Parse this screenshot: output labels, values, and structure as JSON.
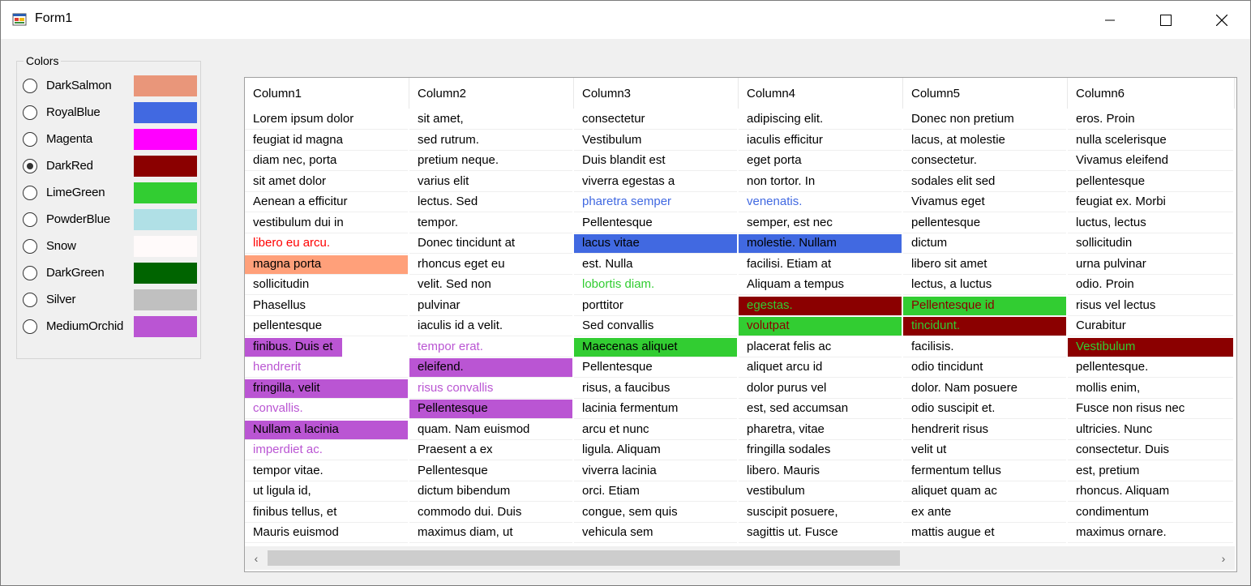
{
  "window": {
    "title": "Form1"
  },
  "colors": {
    "label": "Colors",
    "items": [
      {
        "name": "DarkSalmon",
        "hex": "#e9967a",
        "selected": false
      },
      {
        "name": "RoyalBlue",
        "hex": "#4169e1",
        "selected": false
      },
      {
        "name": "Magenta",
        "hex": "#ff00ff",
        "selected": false
      },
      {
        "name": "DarkRed",
        "hex": "#8b0000",
        "selected": true
      },
      {
        "name": "LimeGreen",
        "hex": "#32cd32",
        "selected": false
      },
      {
        "name": "PowderBlue",
        "hex": "#b0e0e6",
        "selected": false
      },
      {
        "name": "Snow",
        "hex": "#fffafa",
        "selected": false
      },
      {
        "name": "DarkGreen",
        "hex": "#006400",
        "selected": false
      },
      {
        "name": "Silver",
        "hex": "#c0c0c0",
        "selected": false
      },
      {
        "name": "MediumOrchid",
        "hex": "#ba55d3",
        "selected": false
      }
    ]
  },
  "grid": {
    "columns": [
      "Column1",
      "Column2",
      "Column3",
      "Column4",
      "Column5",
      "Column6"
    ],
    "rows": [
      [
        {
          "text": "Lorem ipsum dolor"
        },
        {
          "text": "sit amet,"
        },
        {
          "text": "consectetur"
        },
        {
          "text": "adipiscing elit."
        },
        {
          "text": "Donec non pretium"
        },
        {
          "text": "eros. Proin"
        }
      ],
      [
        {
          "text": "feugiat id magna"
        },
        {
          "text": "sed rutrum."
        },
        {
          "text": "Vestibulum"
        },
        {
          "text": "iaculis efficitur"
        },
        {
          "text": "lacus, at molestie"
        },
        {
          "text": "nulla scelerisque"
        }
      ],
      [
        {
          "text": "diam nec, porta"
        },
        {
          "text": "pretium neque."
        },
        {
          "text": "Duis blandit est"
        },
        {
          "text": "eget porta"
        },
        {
          "text": "consectetur."
        },
        {
          "text": "Vivamus eleifend"
        }
      ],
      [
        {
          "text": "sit amet dolor"
        },
        {
          "text": "varius elit"
        },
        {
          "text": "viverra egestas a"
        },
        {
          "text": "non tortor. In"
        },
        {
          "text": "sodales elit sed"
        },
        {
          "text": "pellentesque"
        }
      ],
      [
        {
          "text": "Aenean a efficitur"
        },
        {
          "text": "lectus. Sed"
        },
        {
          "text": "pharetra semper",
          "fg": "#4169e1"
        },
        {
          "text": "venenatis.",
          "fg": "#4169e1"
        },
        {
          "text": "Vivamus eget"
        },
        {
          "text": "feugiat ex. Morbi"
        }
      ],
      [
        {
          "text": "vestibulum dui in"
        },
        {
          "text": "tempor."
        },
        {
          "text": "Pellentesque"
        },
        {
          "text": "semper, est nec"
        },
        {
          "text": "pellentesque"
        },
        {
          "text": "luctus, lectus"
        }
      ],
      [
        {
          "text": "libero eu arcu.",
          "fg": "#ff0000"
        },
        {
          "text": "Donec tincidunt at"
        },
        {
          "text": "lacus vitae",
          "bg": "#4169e1"
        },
        {
          "text": "molestie. Nullam",
          "bg": "#4169e1"
        },
        {
          "text": "dictum"
        },
        {
          "text": "sollicitudin"
        }
      ],
      [
        {
          "text": "magna porta",
          "bg": "#ffa07a"
        },
        {
          "text": "rhoncus eget eu"
        },
        {
          "text": "est. Nulla"
        },
        {
          "text": "facilisi. Etiam at"
        },
        {
          "text": "libero sit amet"
        },
        {
          "text": "urna pulvinar"
        }
      ],
      [
        {
          "text": "sollicitudin"
        },
        {
          "text": "velit. Sed non"
        },
        {
          "text": "lobortis diam.",
          "fg": "#32cd32"
        },
        {
          "text": "Aliquam a tempus"
        },
        {
          "text": "lectus, a luctus"
        },
        {
          "text": "odio. Proin"
        }
      ],
      [
        {
          "text": "Phasellus"
        },
        {
          "text": "pulvinar"
        },
        {
          "text": "porttitor"
        },
        {
          "text": "egestas.",
          "bg": "#8b0000",
          "fg": "#32cd32"
        },
        {
          "text": "Pellentesque id",
          "bg": "#32cd32",
          "fg": "#8b0000"
        },
        {
          "text": "risus vel lectus"
        }
      ],
      [
        {
          "text": "pellentesque"
        },
        {
          "text": "iaculis id a velit."
        },
        {
          "text": "Sed convallis"
        },
        {
          "text": "volutpat",
          "bg": "#32cd32",
          "fg": "#8b0000"
        },
        {
          "text": "tincidunt.",
          "bg": "#8b0000",
          "fg": "#32cd32"
        },
        {
          "text": "Curabitur"
        }
      ],
      [
        {
          "text": "finibus. Duis et",
          "bg": "#ba55d3",
          "short": true
        },
        {
          "text": "tempor erat.",
          "fg": "#ba55d3"
        },
        {
          "text": "Maecenas aliquet",
          "bg": "#32cd32"
        },
        {
          "text": "placerat felis ac"
        },
        {
          "text": "facilisis."
        },
        {
          "text": "Vestibulum",
          "bg": "#8b0000",
          "fg": "#32cd32"
        }
      ],
      [
        {
          "text": "hendrerit",
          "fg": "#ba55d3"
        },
        {
          "text": "eleifend.",
          "bg": "#ba55d3"
        },
        {
          "text": "Pellentesque"
        },
        {
          "text": "aliquet arcu id"
        },
        {
          "text": "odio tincidunt"
        },
        {
          "text": "pellentesque."
        }
      ],
      [
        {
          "text": "fringilla, velit",
          "bg": "#ba55d3"
        },
        {
          "text": "risus convallis",
          "fg": "#ba55d3"
        },
        {
          "text": "risus, a faucibus"
        },
        {
          "text": "dolor purus vel"
        },
        {
          "text": "dolor. Nam posuere"
        },
        {
          "text": "mollis enim,"
        }
      ],
      [
        {
          "text": "convallis.",
          "fg": "#ba55d3"
        },
        {
          "text": "Pellentesque",
          "bg": "#ba55d3"
        },
        {
          "text": "lacinia fermentum"
        },
        {
          "text": "est, sed accumsan"
        },
        {
          "text": "odio suscipit et."
        },
        {
          "text": "Fusce non risus nec"
        }
      ],
      [
        {
          "text": "Nullam a lacinia",
          "bg": "#ba55d3"
        },
        {
          "text": "quam. Nam euismod"
        },
        {
          "text": "arcu et nunc"
        },
        {
          "text": "pharetra, vitae"
        },
        {
          "text": "hendrerit risus"
        },
        {
          "text": "ultricies. Nunc"
        }
      ],
      [
        {
          "text": "imperdiet ac.",
          "fg": "#ba55d3"
        },
        {
          "text": "Praesent a ex"
        },
        {
          "text": "ligula. Aliquam"
        },
        {
          "text": "fringilla sodales"
        },
        {
          "text": "velit ut"
        },
        {
          "text": "consectetur. Duis"
        }
      ],
      [
        {
          "text": "tempor vitae."
        },
        {
          "text": "Pellentesque"
        },
        {
          "text": "viverra lacinia"
        },
        {
          "text": "libero. Mauris"
        },
        {
          "text": "fermentum tellus"
        },
        {
          "text": "est, pretium"
        }
      ],
      [
        {
          "text": "ut ligula id,"
        },
        {
          "text": "dictum bibendum"
        },
        {
          "text": "orci. Etiam"
        },
        {
          "text": "vestibulum"
        },
        {
          "text": "aliquet quam ac"
        },
        {
          "text": "rhoncus. Aliquam"
        }
      ],
      [
        {
          "text": "finibus tellus, et"
        },
        {
          "text": "commodo dui. Duis"
        },
        {
          "text": "congue, sem quis"
        },
        {
          "text": "suscipit posuere,"
        },
        {
          "text": "ex ante"
        },
        {
          "text": "condimentum"
        }
      ],
      [
        {
          "text": "Mauris euismod"
        },
        {
          "text": "maximus diam, ut"
        },
        {
          "text": "vehicula sem"
        },
        {
          "text": "sagittis ut. Fusce"
        },
        {
          "text": "mattis augue et"
        },
        {
          "text": "maximus ornare."
        }
      ]
    ],
    "scrollbar": {
      "left_arrow": "‹",
      "right_arrow": "›"
    }
  }
}
